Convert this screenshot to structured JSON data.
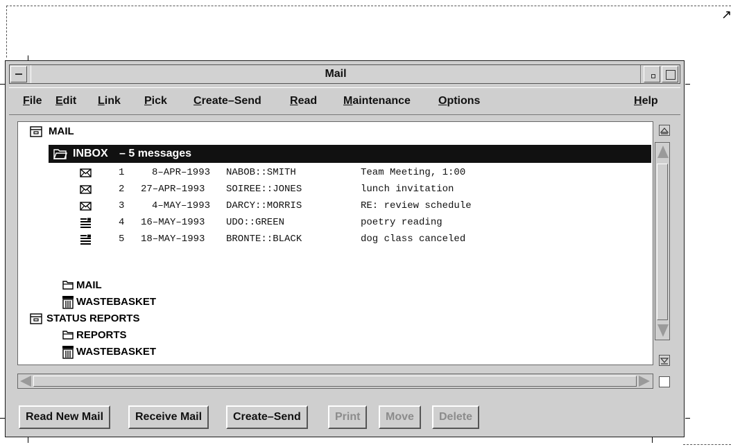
{
  "window": {
    "title": "Mail"
  },
  "menu": {
    "items": [
      {
        "label": "File"
      },
      {
        "label": "Edit"
      },
      {
        "label": "Link"
      },
      {
        "label": "Pick"
      },
      {
        "label": "Create–Send"
      },
      {
        "label": "Read"
      },
      {
        "label": "Maintenance"
      },
      {
        "label": "Options"
      },
      {
        "label": "Help"
      }
    ]
  },
  "tree": {
    "root": {
      "label": "MAIL"
    },
    "inbox": {
      "label": "INBOX",
      "info": "– 5 messages"
    },
    "messages": [
      {
        "num": "1",
        "date": "8–APR–1993",
        "from": "NABOB::SMITH",
        "subject": "Team Meeting, 1:00",
        "icon": "envelope-icon"
      },
      {
        "num": "2",
        "date": "27–APR–1993",
        "from": "SOIREE::JONES",
        "subject": "lunch invitation",
        "icon": "envelope-icon"
      },
      {
        "num": "3",
        "date": "4–MAY–1993",
        "from": "DARCY::MORRIS",
        "subject": "RE: review schedule",
        "icon": "envelope-icon"
      },
      {
        "num": "4",
        "date": "16–MAY–1993",
        "from": "UDO::GREEN",
        "subject": "poetry reading",
        "icon": "note-icon"
      },
      {
        "num": "5",
        "date": "18–MAY–1993",
        "from": "BRONTE::BLACK",
        "subject": "dog class canceled",
        "icon": "note-icon"
      }
    ],
    "folders": [
      {
        "label": "MAIL",
        "icon": "folder-icon"
      },
      {
        "label": "WASTEBASKET",
        "icon": "trash-icon"
      },
      {
        "label": "STATUS REPORTS",
        "icon": "drawer-icon"
      },
      {
        "label": "REPORTS",
        "icon": "folder-icon"
      },
      {
        "label": "WASTEBASKET",
        "icon": "trash-icon"
      }
    ]
  },
  "buttons": [
    {
      "label": "Read New Mail",
      "enabled": true
    },
    {
      "label": "Receive Mail",
      "enabled": true
    },
    {
      "label": "Create–Send",
      "enabled": true
    },
    {
      "label": "Print",
      "enabled": false
    },
    {
      "label": "Move",
      "enabled": false
    },
    {
      "label": "Delete",
      "enabled": false
    }
  ],
  "colors": {
    "window_bg": "#cfcfcf",
    "selection": "#111111",
    "disabled_text": "#8c8c8c"
  }
}
